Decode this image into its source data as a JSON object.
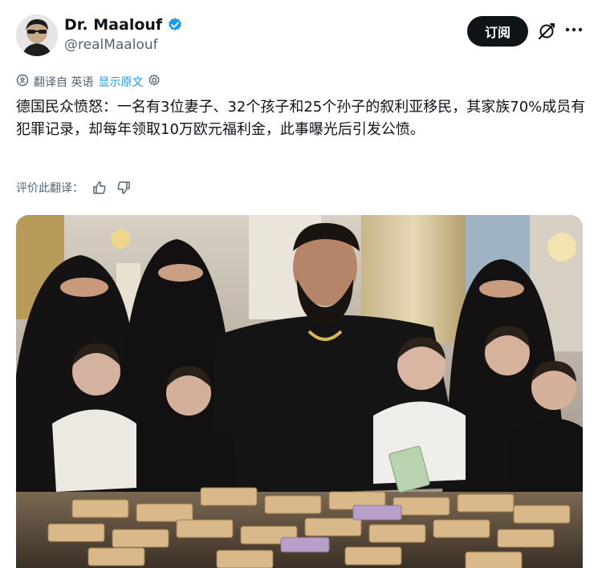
{
  "author": {
    "display_name": "Dr. Maalouf",
    "handle": "@realMaalouf",
    "verified": true
  },
  "actions": {
    "subscribe_label": "订阅",
    "grok_icon": "grok-icon",
    "more_icon": "more-icon"
  },
  "translation": {
    "translated_from": "翻译自 英语",
    "show_original": "显示原文",
    "settings_icon": "gear-icon"
  },
  "post": {
    "text": "德国民众愤怒：一名有3位妻子、32个孩子和25个孙子的叙利亚移民，其家族70%成员有犯罪记录，却每年领取10万欧元福利金，此事曝光后引发公愤。"
  },
  "rating": {
    "label": "评价此翻译：",
    "like_icon": "thumbs-up-icon",
    "dislike_icon": "thumbs-down-icon"
  },
  "colors": {
    "link": "#1d9bf0",
    "verified": "#1d9bf0",
    "secondary_text": "#536471",
    "primary_text": "#0f1419"
  }
}
